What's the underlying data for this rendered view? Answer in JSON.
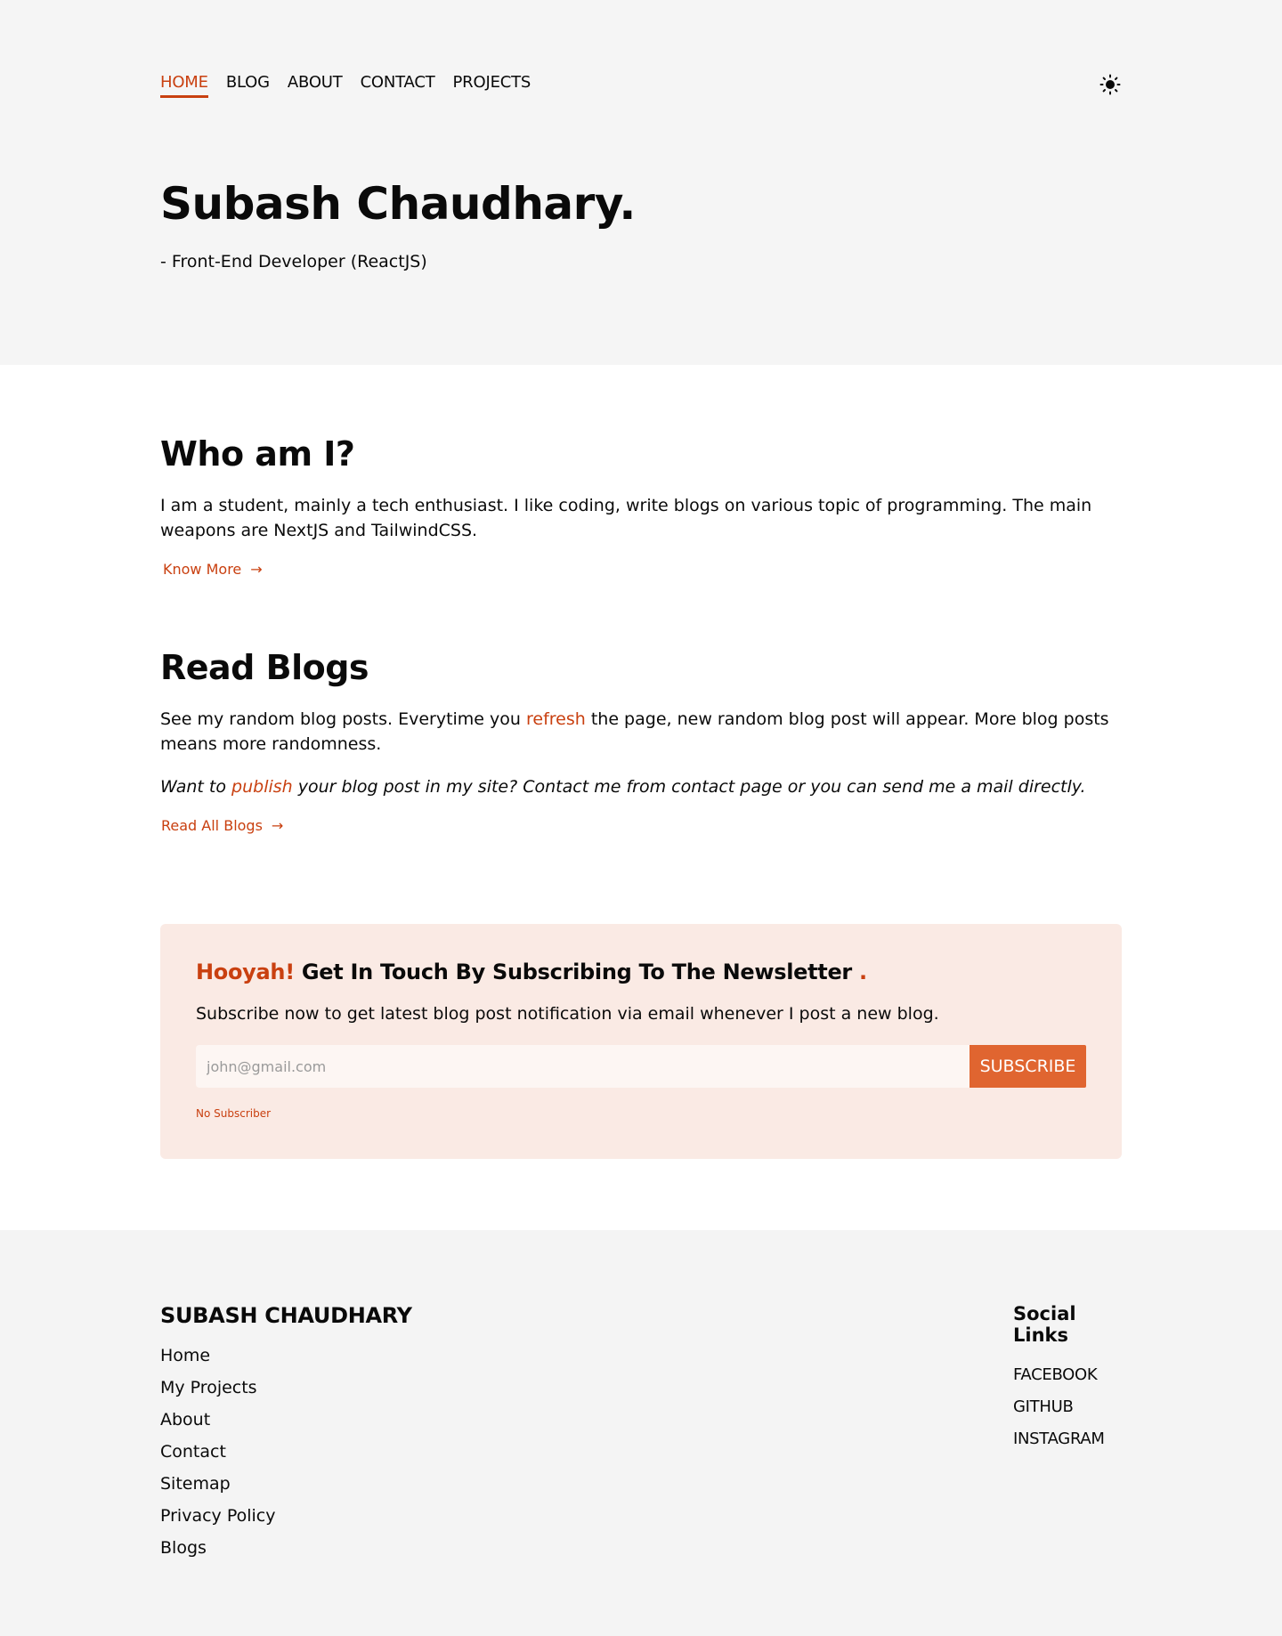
{
  "nav": {
    "items": [
      "HOME",
      "BLOG",
      "ABOUT",
      "CONTACT",
      "PROJECTS"
    ],
    "active": "HOME",
    "theme_icon": "sun-icon"
  },
  "hero": {
    "title": "Subash Chaudhary.",
    "subtitle": "- Front-End Developer (ReactJS)"
  },
  "who": {
    "title": "Who am I?",
    "text": "I am a student, mainly a tech enthusiast. I like coding, write blogs on various topic of programming. The main weapons are NextJS and TailwindCSS.",
    "link": "Know More",
    "arrow": "→"
  },
  "blogs": {
    "title": "Read Blogs",
    "text_before": "See my random blog posts. Everytime you ",
    "text_link": "refresh",
    "text_after": " the page, new random blog post will appear. More blog posts means more randomness.",
    "italic_before": "Want to ",
    "italic_link": "publish",
    "italic_after": " your blog post in my site? Contact me from contact page or you can send me a mail directly.",
    "link": "Read All Blogs",
    "arrow": "→"
  },
  "newsletter": {
    "title_accent": "Hooyah!",
    "title": "Get In Touch By Subscribing To The Newsletter",
    "title_dot": ".",
    "description": "Subscribe now to get latest blog post notification via email whenever I post a new blog.",
    "input_placeholder": "john@gmail.com",
    "input_value": "",
    "button": "SUBSCRIBE",
    "count_text": "No Subscriber"
  },
  "footer": {
    "brand": "SUBASH CHAUDHARY",
    "links": [
      "Home",
      "My Projects",
      "About",
      "Contact",
      "Sitemap",
      "Privacy Policy",
      "Blogs"
    ],
    "social_title": "Social Links",
    "social_links": [
      "FACEBOOK",
      "GITHUB",
      "INSTAGRAM"
    ]
  },
  "colors": {
    "accent": "#c94010",
    "button": "#e06530",
    "newsletter_bg": "#faeae4"
  }
}
